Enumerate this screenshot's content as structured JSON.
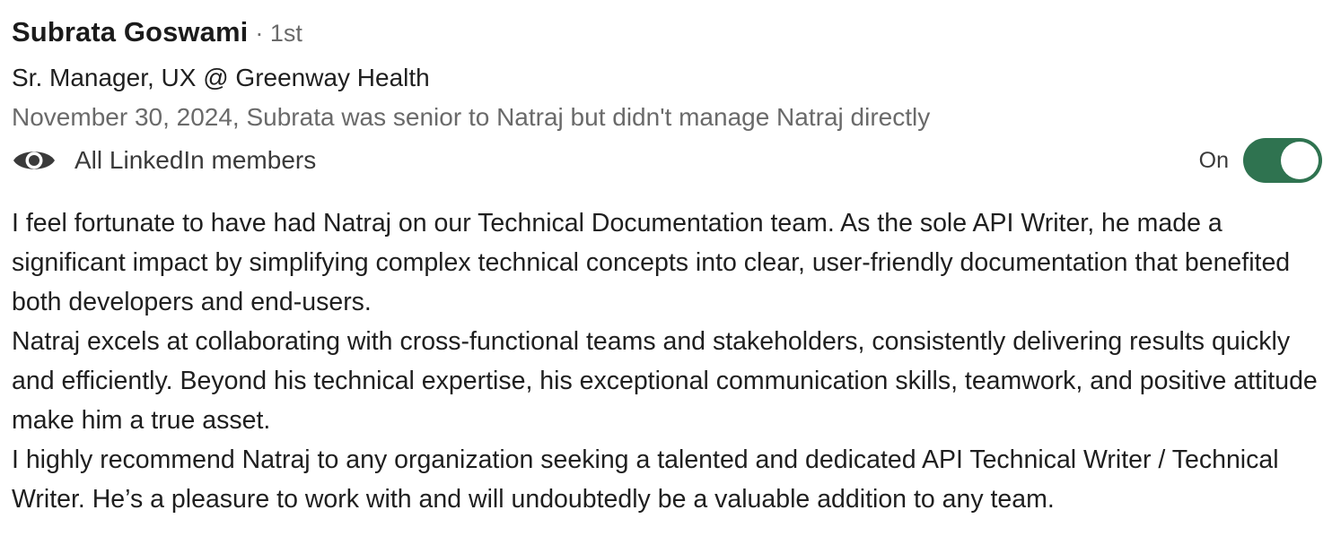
{
  "recommendation": {
    "author_name": "Subrata Goswami",
    "connection_degree": "· 1st",
    "headline": "Sr. Manager, UX @ Greenway Health",
    "meta": "November 30, 2024, Subrata was senior to Natraj but didn't manage Natraj directly",
    "visibility": {
      "icon": "eye-icon",
      "label": "All LinkedIn members",
      "toggle_state_label": "On",
      "toggle_on": true,
      "toggle_color": "#2f7350"
    },
    "paragraphs": [
      "I feel fortunate to have had Natraj on our Technical Documentation team. As the sole API Writer, he made a significant impact by simplifying complex technical concepts into clear, user-friendly documentation that benefited both developers and end-users.",
      "Natraj excels at collaborating with cross-functional teams and stakeholders, consistently delivering results quickly and efficiently. Beyond his technical expertise, his exceptional communication skills, teamwork, and positive attitude make him a true asset.",
      "I highly recommend Natraj to any organization seeking a talented and dedicated API Technical Writer / Technical Writer. He’s a pleasure to work with and will undoubtedly be a valuable addition to any team."
    ]
  }
}
